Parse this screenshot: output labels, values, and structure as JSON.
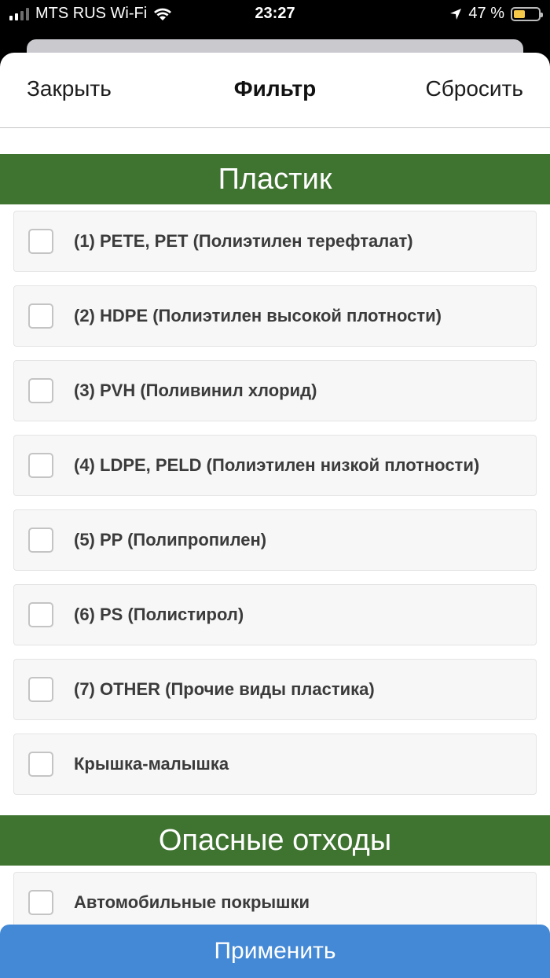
{
  "status_bar": {
    "carrier": "MTS RUS Wi-Fi",
    "time": "23:27",
    "battery": "47 %",
    "battery_level": 0.47,
    "icons": [
      "signal-icon",
      "wifi-icon",
      "location-arrow-icon",
      "battery-icon"
    ]
  },
  "header": {
    "close_label": "Закрыть",
    "title": "Фильтр",
    "reset_label": "Сбросить"
  },
  "sections": [
    {
      "title": "Пластик",
      "items": [
        {
          "label": "(1) PETE, PET (Полиэтилен терефталат)",
          "checked": false
        },
        {
          "label": "(2) HDPE (Полиэтилен высокой плотности)",
          "checked": false
        },
        {
          "label": "(3) PVH (Поливинил хлорид)",
          "checked": false
        },
        {
          "label": "(4) LDPE, PELD (Полиэтилен низкой плотности)",
          "checked": false
        },
        {
          "label": "(5) PP (Полипропилен)",
          "checked": false
        },
        {
          "label": "(6) PS (Полистирол)",
          "checked": false
        },
        {
          "label": "(7) OTHER (Прочие виды пластика)",
          "checked": false
        },
        {
          "label": "Крышка-малышка",
          "checked": false
        }
      ]
    },
    {
      "title": "Опасные отходы",
      "items": [
        {
          "label": "Автомобильные покрышки",
          "checked": false
        }
      ]
    }
  ],
  "apply_label": "Применить",
  "colors": {
    "section_header": "#3f7330",
    "apply_button": "#4489d6"
  }
}
